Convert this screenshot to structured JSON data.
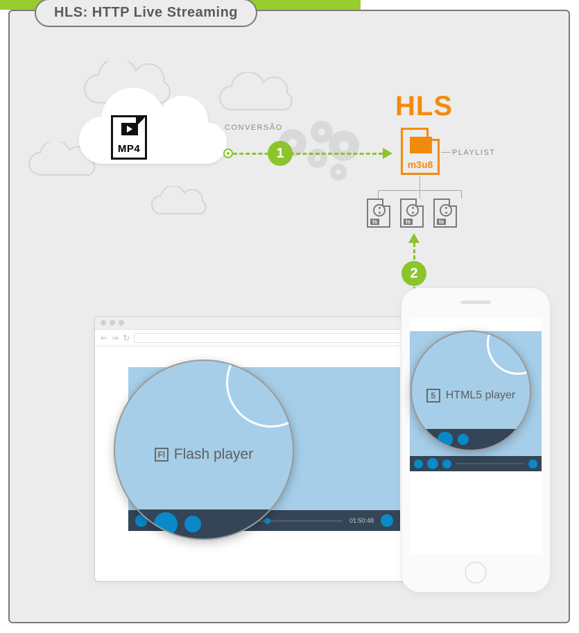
{
  "title": "HLS: HTTP Live Streaming",
  "source_format": "MP4",
  "step1_label": "CONVERSÃO",
  "step1_number": "1",
  "hls_heading": "HLS",
  "playlist_label": "PLAYLIST",
  "playlist_format": "m3u8",
  "ts_label": "ts",
  "step2_number": "2",
  "flash": {
    "label": "Flash player",
    "icon": "Fl",
    "timecode": "01:50:48"
  },
  "html5": {
    "label": "HTML5 player",
    "icon": "5"
  }
}
